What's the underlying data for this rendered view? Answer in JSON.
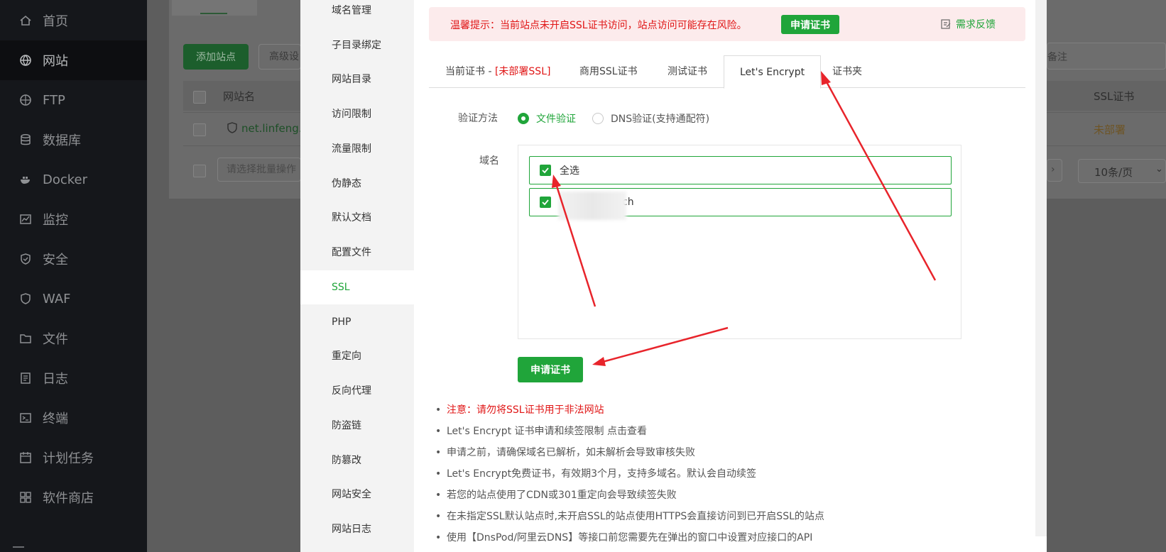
{
  "sidebar": {
    "items": [
      {
        "label": "首页",
        "icon": "home-icon"
      },
      {
        "label": "网站",
        "icon": "globe-icon"
      },
      {
        "label": "FTP",
        "icon": "ftp-icon"
      },
      {
        "label": "数据库",
        "icon": "database-icon"
      },
      {
        "label": "Docker",
        "icon": "docker-icon"
      },
      {
        "label": "监控",
        "icon": "monitor-icon"
      },
      {
        "label": "安全",
        "icon": "shield-icon"
      },
      {
        "label": "WAF",
        "icon": "waf-icon"
      },
      {
        "label": "文件",
        "icon": "folder-icon"
      },
      {
        "label": "日志",
        "icon": "log-icon"
      },
      {
        "label": "终端",
        "icon": "terminal-icon"
      },
      {
        "label": "计划任务",
        "icon": "calendar-icon"
      },
      {
        "label": "软件商店",
        "icon": "apps-icon"
      }
    ],
    "active_index": 1
  },
  "background": {
    "add_site_label": "添加站点",
    "advanced_label": "高级设",
    "column_site_name": "网站名",
    "site_name": "net.linfeng.t",
    "batch_placeholder": "请选择批量操作",
    "column_ssl": "SSL证书",
    "ssl_status": "未部署",
    "remark_placeholder": "备注",
    "page_size": "10条/页"
  },
  "modal": {
    "menu": [
      "域名管理",
      "子目录绑定",
      "网站目录",
      "访问限制",
      "流量限制",
      "伪静态",
      "默认文档",
      "配置文件",
      "SSL",
      "PHP",
      "重定向",
      "反向代理",
      "防盗链",
      "防篡改",
      "网站安全",
      "网站日志"
    ],
    "menu_active_index": 8,
    "alert": {
      "text": "温馨提示：当前站点未开启SSL证书访问，站点访问可能存在风险。",
      "apply_label": "申请证书",
      "feedback_label": "需求反馈"
    },
    "tabs": {
      "current_prefix": "当前证书 - ",
      "current_status": "[未部署SSL]",
      "commercial": "商用SSL证书",
      "test": "测试证书",
      "letsencrypt": "Let's Encrypt",
      "folder": "证书夹"
    },
    "verify": {
      "label": "验证方法",
      "file": "文件验证",
      "dns": "DNS验证(支持通配符)"
    },
    "domain": {
      "label": "域名",
      "select_all": "全选",
      "entry_suffix": "ch"
    },
    "apply_label": "申请证书",
    "notes": [
      "注意：请勿将SSL证书用于非法网站",
      "Let's Encrypt 证书申请和续签限制 点击查看",
      "申请之前，请确保域名已解析，如未解析会导致审核失败",
      "Let's Encrypt免费证书，有效期3个月，支持多域名。默认会自动续签",
      "若您的站点使用了CDN或301重定向会导致续签失败",
      "在未指定SSL默认站点时,未开启SSL的站点使用HTTPS会直接访问到已开启SSL的站点",
      "使用【DnsPod/阿里云DNS】等接口前您需要先在弹出的窗口中设置对应接口的API"
    ]
  },
  "colors": {
    "brand_green": "#20a53a",
    "warning_red": "#e01616",
    "annotation_red": "#e8242b"
  }
}
